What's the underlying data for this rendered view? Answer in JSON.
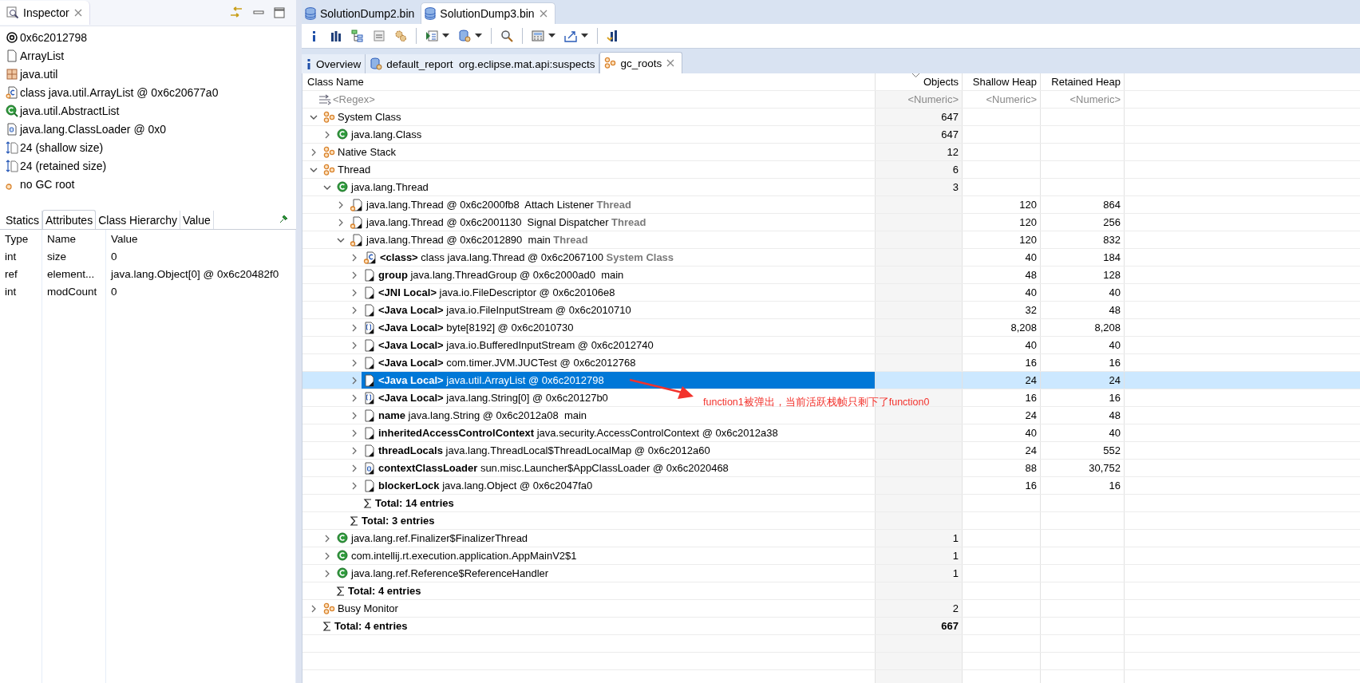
{
  "inspector": {
    "title": "Inspector",
    "items": [
      {
        "kind": "address",
        "text": "0x6c2012798"
      },
      {
        "kind": "file",
        "text": "ArrayList"
      },
      {
        "kind": "package",
        "text": "java.util"
      },
      {
        "kind": "classref",
        "text": "class java.util.ArrayList @ 0x6c20677a0"
      },
      {
        "kind": "superclass",
        "text": "java.util.AbstractList"
      },
      {
        "kind": "loader",
        "text": "java.lang.ClassLoader @ 0x0"
      },
      {
        "kind": "size",
        "text": "24 (shallow size)"
      },
      {
        "kind": "size",
        "text": "24 (retained size)"
      },
      {
        "kind": "gcroot",
        "text": "no GC root"
      }
    ],
    "tabs": [
      {
        "label": "Statics",
        "selected": false
      },
      {
        "label": "Attributes",
        "selected": true
      },
      {
        "label": "Class Hierarchy",
        "selected": false
      },
      {
        "label": "Value",
        "selected": false
      }
    ],
    "columns": [
      "Type",
      "Name",
      "Value"
    ],
    "rows": [
      [
        "int",
        "size",
        "0"
      ],
      [
        "ref",
        "element...",
        "java.lang.Object[0] @ 0x6c20482f0"
      ],
      [
        "int",
        "modCount",
        "0"
      ]
    ]
  },
  "editor_tabs": [
    {
      "label": "SolutionDump2.bin",
      "selected": false
    },
    {
      "label": "SolutionDump3.bin",
      "selected": true
    }
  ],
  "query_tabs": [
    {
      "kind": "info",
      "label": "Overview",
      "selected": false
    },
    {
      "kind": "report",
      "label": "default_report  org.eclipse.mat.api:suspects",
      "selected": false
    },
    {
      "kind": "roots",
      "label": "gc_roots",
      "selected": true
    }
  ],
  "table": {
    "columns": [
      "Class Name",
      "Objects",
      "Shallow Heap",
      "Retained Heap"
    ],
    "filters": [
      "<Regex>",
      "<Numeric>",
      "<Numeric>",
      "<Numeric>"
    ],
    "rows": [
      {
        "kind": "group",
        "name": "System Class",
        "objects": "647",
        "expanded": true,
        "selected": false,
        "children": [
          {
            "kind": "class",
            "name": "java.lang.Class",
            "objects": "647",
            "expanded": false,
            "selected": false
          }
        ]
      },
      {
        "kind": "group",
        "name": "Native Stack",
        "objects": "12",
        "expanded": false,
        "selected": false
      },
      {
        "kind": "group",
        "name": "Thread",
        "objects": "6",
        "expanded": true,
        "selected": false,
        "children": [
          {
            "kind": "class",
            "name": "java.lang.Thread",
            "objects": "3",
            "expanded": true,
            "selected": false,
            "children": [
              {
                "kind": "thread",
                "name": "java.lang.Thread @ 0x6c2000fb8  Attach Listener",
                "suffix": "Thread",
                "shallow": "120",
                "retained": "864",
                "expanded": false,
                "selected": false
              },
              {
                "kind": "thread",
                "name": "java.lang.Thread @ 0x6c2001130  Signal Dispatcher",
                "suffix": "Thread",
                "shallow": "120",
                "retained": "256",
                "expanded": false,
                "selected": false
              },
              {
                "kind": "thread",
                "name": "java.lang.Thread @ 0x6c2012890  main",
                "suffix": "Thread",
                "shallow": "120",
                "retained": "832",
                "expanded": true,
                "selected": false,
                "children": [
                  {
                    "kind": "classobj",
                    "field": "<class>",
                    "name": "class java.lang.Thread @ 0x6c2067100",
                    "suffix": "System Class",
                    "shallow": "40",
                    "retained": "184",
                    "expanded": false,
                    "selected": false
                  },
                  {
                    "kind": "object",
                    "field": "group",
                    "name": "java.lang.ThreadGroup @ 0x6c2000ad0  main",
                    "shallow": "48",
                    "retained": "128",
                    "expanded": false,
                    "selected": false
                  },
                  {
                    "kind": "object",
                    "field": "<JNI Local>",
                    "name": "java.io.FileDescriptor @ 0x6c20106e8",
                    "shallow": "40",
                    "retained": "40",
                    "expanded": false,
                    "selected": false
                  },
                  {
                    "kind": "object",
                    "field": "<Java Local>",
                    "name": "java.io.FileInputStream @ 0x6c2010710",
                    "shallow": "32",
                    "retained": "48",
                    "expanded": false,
                    "selected": false
                  },
                  {
                    "kind": "array",
                    "field": "<Java Local>",
                    "name": "byte[8192] @ 0x6c2010730",
                    "shallow": "8,208",
                    "retained": "8,208",
                    "expanded": false,
                    "selected": false
                  },
                  {
                    "kind": "object",
                    "field": "<Java Local>",
                    "name": "java.io.BufferedInputStream @ 0x6c2012740",
                    "shallow": "40",
                    "retained": "40",
                    "expanded": false,
                    "selected": false
                  },
                  {
                    "kind": "object",
                    "field": "<Java Local>",
                    "name": "com.timer.JVM.JUCTest @ 0x6c2012768",
                    "shallow": "16",
                    "retained": "16",
                    "expanded": false,
                    "selected": false
                  },
                  {
                    "kind": "object",
                    "field": "<Java Local>",
                    "name": "java.util.ArrayList @ 0x6c2012798",
                    "shallow": "24",
                    "retained": "24",
                    "expanded": false,
                    "selected": true
                  },
                  {
                    "kind": "array",
                    "field": "<Java Local>",
                    "name": "java.lang.String[0] @ 0x6c20127b0",
                    "shallow": "16",
                    "retained": "16",
                    "expanded": false,
                    "selected": false
                  },
                  {
                    "kind": "object",
                    "field": "name",
                    "name": "java.lang.String @ 0x6c2012a08  main",
                    "shallow": "24",
                    "retained": "48",
                    "expanded": false,
                    "selected": false
                  },
                  {
                    "kind": "object",
                    "field": "inheritedAccessControlContext",
                    "name": "java.security.AccessControlContext @ 0x6c2012a38",
                    "shallow": "40",
                    "retained": "40",
                    "expanded": false,
                    "selected": false
                  },
                  {
                    "kind": "object",
                    "field": "threadLocals",
                    "name": "java.lang.ThreadLocal$ThreadLocalMap @ 0x6c2012a60",
                    "shallow": "24",
                    "retained": "552",
                    "expanded": false,
                    "selected": false
                  },
                  {
                    "kind": "loader",
                    "field": "contextClassLoader",
                    "name": "sun.misc.Launcher$AppClassLoader @ 0x6c2020468",
                    "shallow": "88",
                    "retained": "30,752",
                    "expanded": false,
                    "selected": false
                  },
                  {
                    "kind": "object",
                    "field": "blockerLock",
                    "name": "java.lang.Object @ 0x6c2047fa0",
                    "shallow": "16",
                    "retained": "16",
                    "expanded": false,
                    "selected": false
                  },
                  {
                    "kind": "total",
                    "name": "Total: 14 entries",
                    "selected": false
                  }
                ]
              },
              {
                "kind": "total",
                "name": "Total: 3 entries",
                "selected": false
              }
            ]
          },
          {
            "kind": "class",
            "name": "java.lang.ref.Finalizer$FinalizerThread",
            "objects": "1",
            "expanded": false,
            "selected": false
          },
          {
            "kind": "class",
            "name": "com.intellij.rt.execution.application.AppMainV2$1",
            "objects": "1",
            "expanded": false,
            "selected": false
          },
          {
            "kind": "class",
            "name": "java.lang.ref.Reference$ReferenceHandler",
            "objects": "1",
            "expanded": false,
            "selected": false
          },
          {
            "kind": "total",
            "name": "Total: 4 entries",
            "selected": false
          }
        ]
      },
      {
        "kind": "group",
        "name": "Busy Monitor",
        "objects": "2",
        "expanded": false,
        "selected": false
      },
      {
        "kind": "total",
        "name": "Total: 4 entries",
        "objects": "667",
        "selected": false
      }
    ]
  },
  "annotation": {
    "text": "function1被弹出，当前活跃栈帧只剩下了function0"
  }
}
